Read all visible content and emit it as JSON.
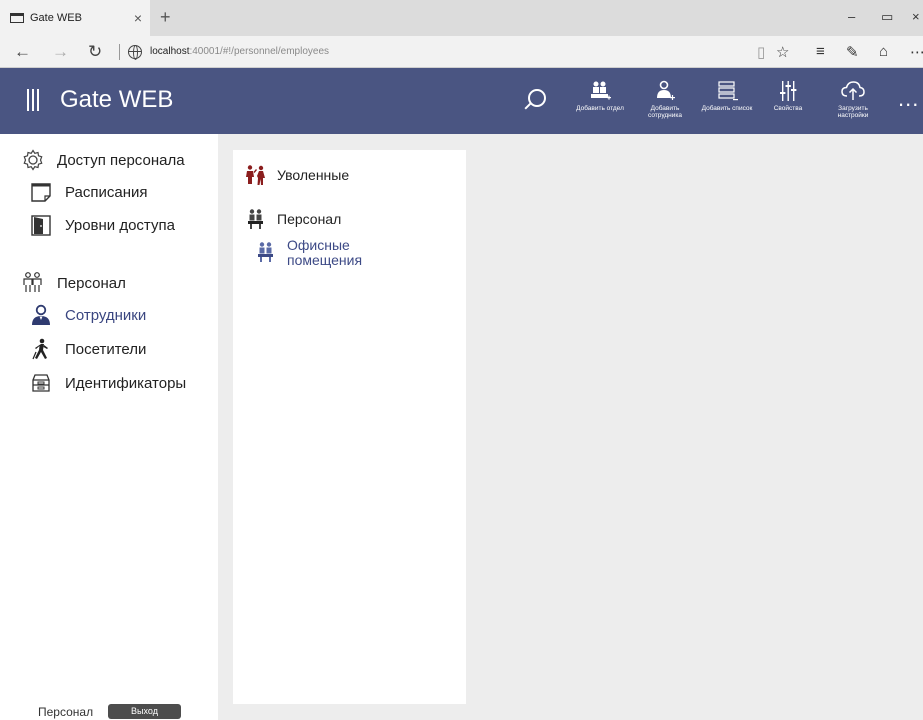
{
  "browser": {
    "tab_title": "Gate WEB",
    "tab_close": "×",
    "new_tab": "+",
    "win_min": "–",
    "win_max": "▭",
    "win_close": "×",
    "nav_back": "←",
    "nav_forward": "→",
    "nav_refresh": "↻",
    "url_host": "localhost",
    "url_rest": ":40001/#!/personnel/employees",
    "reading_view": "▯",
    "favorite": "☆",
    "hub": "≡",
    "notes": "✎",
    "share": "⌂",
    "more": "⋯"
  },
  "app": {
    "title": "Gate WEB",
    "header_buttons": [
      {
        "label": "Добавить отдел",
        "icon": "add-department-icon"
      },
      {
        "label": "Добавить сотрудника",
        "icon": "add-employee-icon"
      },
      {
        "label": "Добавить список",
        "icon": "add-list-icon"
      },
      {
        "label": "Свойства",
        "icon": "properties-icon"
      },
      {
        "label": "Загрузить настройки",
        "icon": "upload-settings-icon"
      }
    ],
    "more_label": "..."
  },
  "sidebar": {
    "access_group": "Доступ персонала",
    "schedules": "Расписания",
    "access_levels": "Уровни доступа",
    "personnel_group": "Персонал",
    "employees": "Сотрудники",
    "visitors": "Посетители",
    "identifiers": "Идентификаторы",
    "footer_user": "Персонал",
    "logout": "Выход"
  },
  "tree": {
    "dismissed": "Уволенные",
    "personnel": "Персонал",
    "offices_line1": "Офисные",
    "offices_line2": "помещения"
  },
  "colors": {
    "header_bg": "#4a5582",
    "active_text": "#3a4680",
    "dismissed_icon": "#8b1e1e",
    "content_bg": "#ededed"
  }
}
